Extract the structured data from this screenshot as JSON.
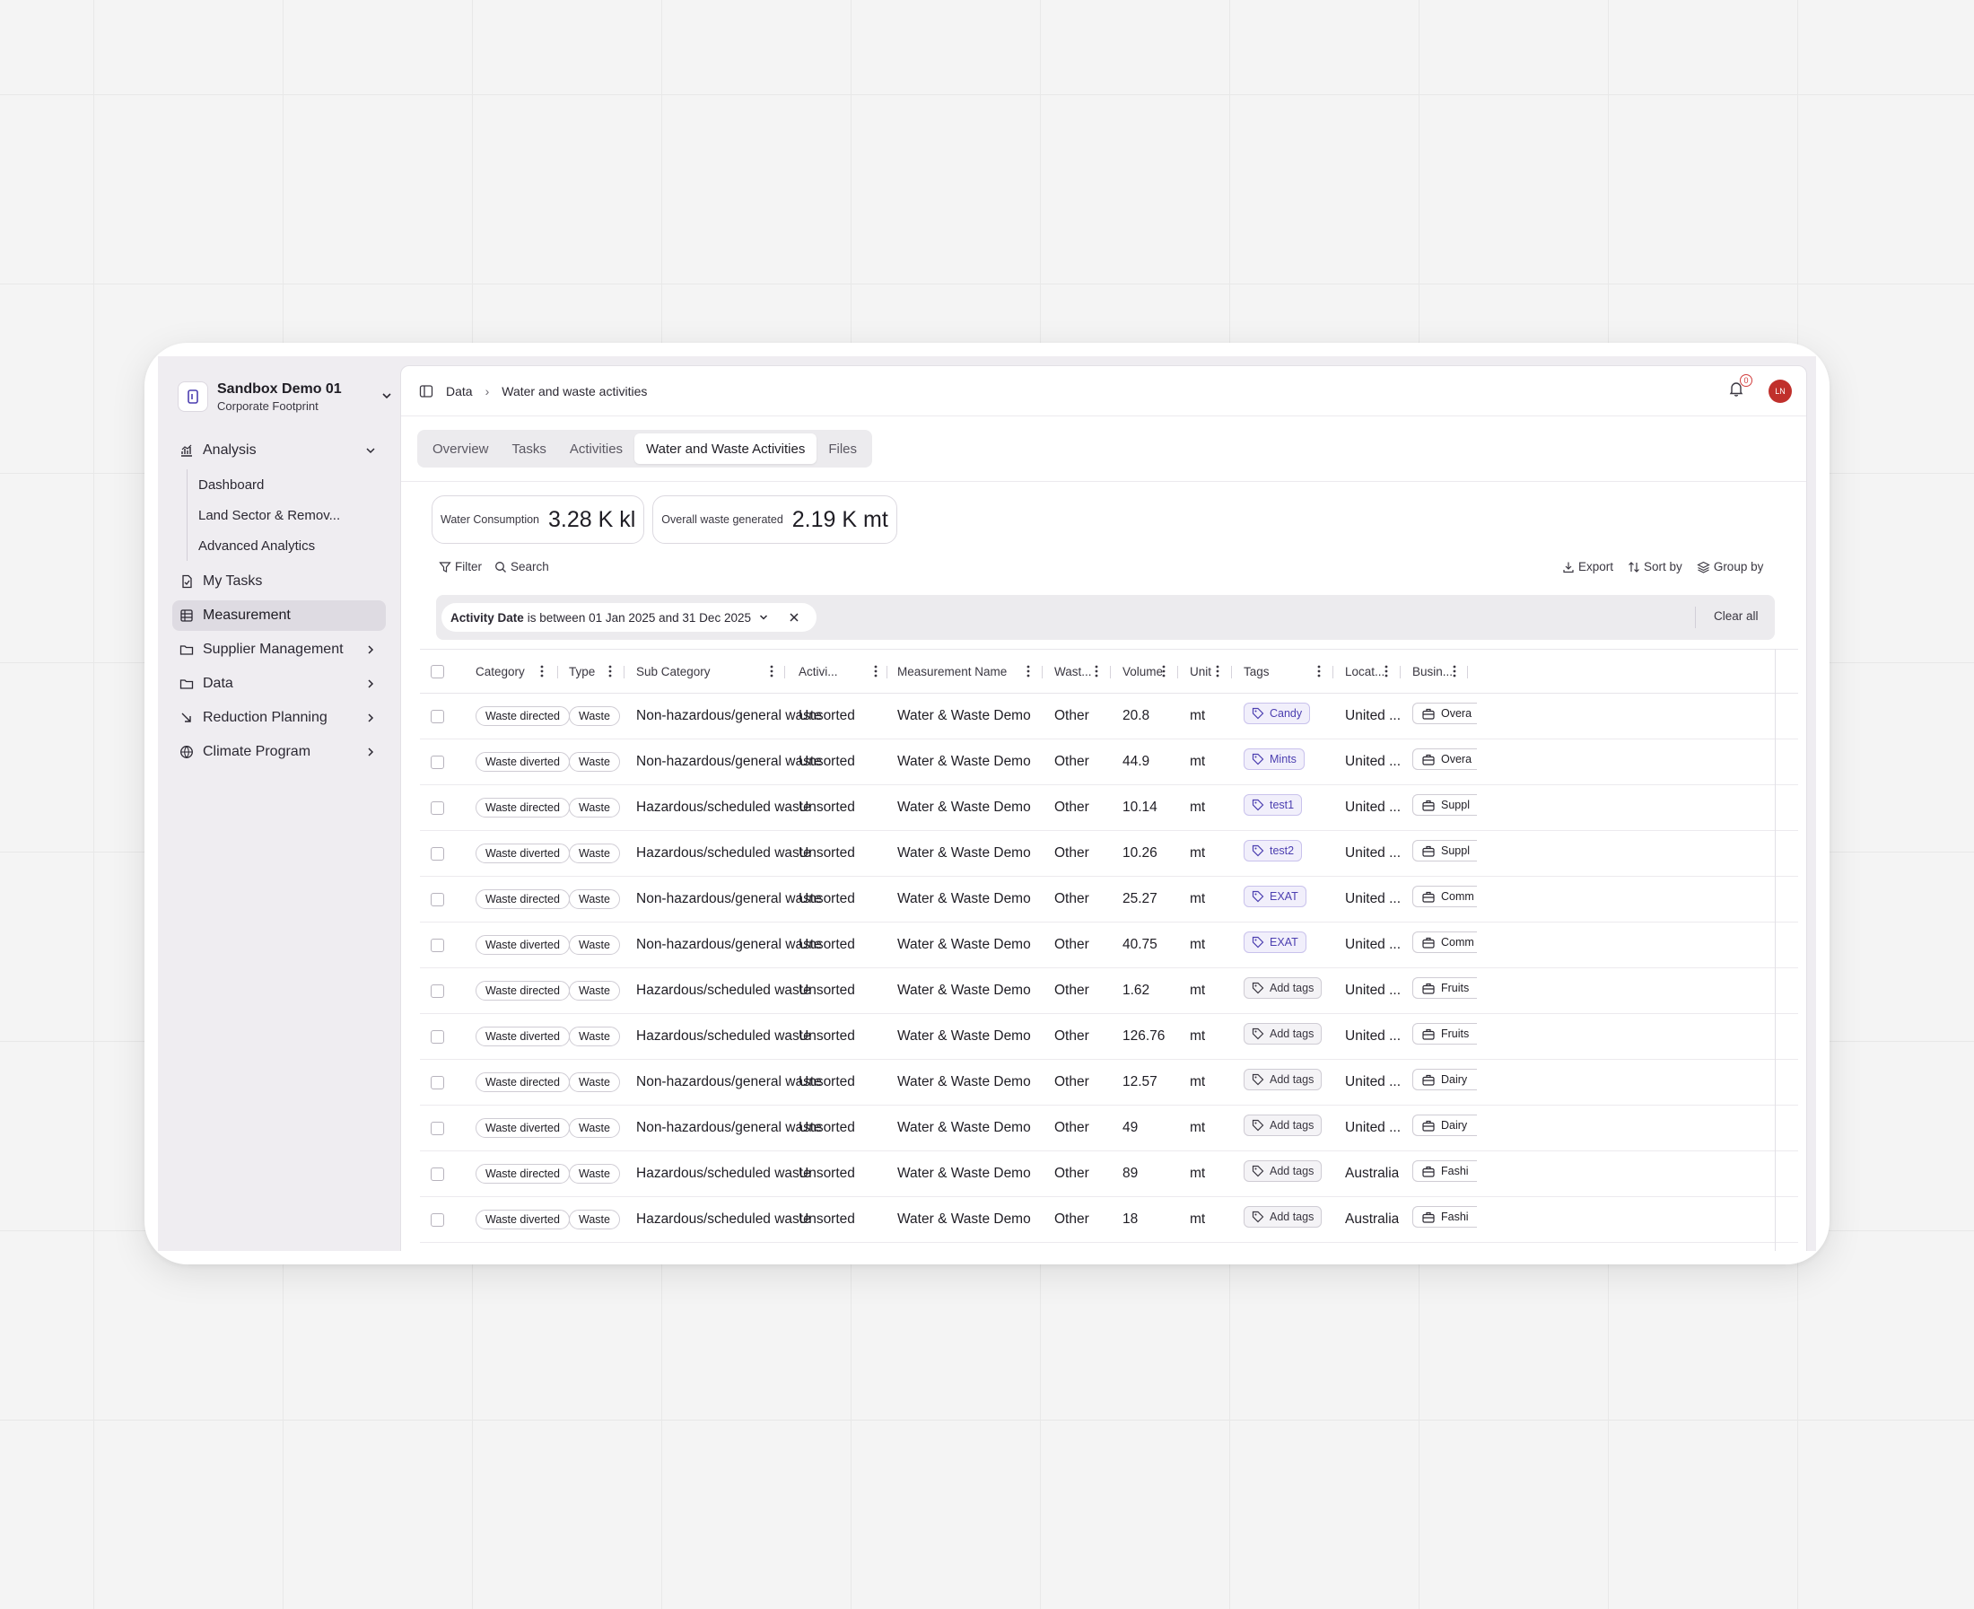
{
  "org": {
    "name": "Sandbox Demo 01",
    "subtitle": "Corporate Footprint"
  },
  "sidebar": {
    "analysis": {
      "label": "Analysis",
      "children": [
        "Dashboard",
        "Land Sector & Remov...",
        "Advanced Analytics"
      ]
    },
    "items": [
      {
        "label": "My Tasks"
      },
      {
        "label": "Measurement"
      },
      {
        "label": "Supplier Management"
      },
      {
        "label": "Data"
      },
      {
        "label": "Reduction Planning"
      },
      {
        "label": "Climate Program"
      }
    ]
  },
  "breadcrumb": [
    "Data",
    "Water and waste activities"
  ],
  "notifications": {
    "count": "0"
  },
  "user": {
    "initials": "LN",
    "avatar_color": "#c0302c"
  },
  "tabs": [
    "Overview",
    "Tasks",
    "Activities",
    "Water and Waste Activities",
    "Files"
  ],
  "active_tab": "Water and Waste Activities",
  "metrics": [
    {
      "label": "Water Consumption",
      "value": "3.28 K kl"
    },
    {
      "label": "Overall waste generated",
      "value": "2.19 K mt"
    }
  ],
  "toolbar": {
    "filter": "Filter",
    "search": "Search",
    "export": "Export",
    "sort_by": "Sort by",
    "group_by": "Group by"
  },
  "filter_chip": {
    "field": "Activity Date",
    "text": "is between 01 Jan 2025 and 31 Dec 2025",
    "clear_all": "Clear all"
  },
  "columns": [
    "Category",
    "Type",
    "Sub Category",
    "Activi...",
    "Measurement Name",
    "Wast...",
    "Volume",
    "Unit",
    "Tags",
    "Locat...",
    "Busin..."
  ],
  "rows": [
    {
      "category": "Waste directed",
      "type": "Waste",
      "subcategory": "Non-hazardous/general waste",
      "activity": "Unsorted",
      "measurement": "Water & Waste Demo",
      "waste": "Other",
      "volume": "20.8",
      "unit": "mt",
      "tag": "Candy",
      "location": "United ...",
      "business": "Overa"
    },
    {
      "category": "Waste diverted",
      "type": "Waste",
      "subcategory": "Non-hazardous/general waste",
      "activity": "Unsorted",
      "measurement": "Water & Waste Demo",
      "waste": "Other",
      "volume": "44.9",
      "unit": "mt",
      "tag": "Mints",
      "location": "United ...",
      "business": "Overa"
    },
    {
      "category": "Waste directed",
      "type": "Waste",
      "subcategory": "Hazardous/scheduled waste",
      "activity": "Unsorted",
      "measurement": "Water & Waste Demo",
      "waste": "Other",
      "volume": "10.14",
      "unit": "mt",
      "tag": "test1",
      "location": "United ...",
      "business": "Suppl"
    },
    {
      "category": "Waste diverted",
      "type": "Waste",
      "subcategory": "Hazardous/scheduled waste",
      "activity": "Unsorted",
      "measurement": "Water & Waste Demo",
      "waste": "Other",
      "volume": "10.26",
      "unit": "mt",
      "tag": "test2",
      "location": "United ...",
      "business": "Suppl"
    },
    {
      "category": "Waste directed",
      "type": "Waste",
      "subcategory": "Non-hazardous/general waste",
      "activity": "Unsorted",
      "measurement": "Water & Waste Demo",
      "waste": "Other",
      "volume": "25.27",
      "unit": "mt",
      "tag": "EXAT",
      "location": "United ...",
      "business": "Comm"
    },
    {
      "category": "Waste diverted",
      "type": "Waste",
      "subcategory": "Non-hazardous/general waste",
      "activity": "Unsorted",
      "measurement": "Water & Waste Demo",
      "waste": "Other",
      "volume": "40.75",
      "unit": "mt",
      "tag": "EXAT",
      "location": "United ...",
      "business": "Comm"
    },
    {
      "category": "Waste directed",
      "type": "Waste",
      "subcategory": "Hazardous/scheduled waste",
      "activity": "Unsorted",
      "measurement": "Water & Waste Demo",
      "waste": "Other",
      "volume": "1.62",
      "unit": "mt",
      "tag": "Add tags",
      "location": "United ...",
      "business": "Fruits"
    },
    {
      "category": "Waste diverted",
      "type": "Waste",
      "subcategory": "Hazardous/scheduled waste",
      "activity": "Unsorted",
      "measurement": "Water & Waste Demo",
      "waste": "Other",
      "volume": "126.76",
      "unit": "mt",
      "tag": "Add tags",
      "location": "United ...",
      "business": "Fruits"
    },
    {
      "category": "Waste directed",
      "type": "Waste",
      "subcategory": "Non-hazardous/general waste",
      "activity": "Unsorted",
      "measurement": "Water & Waste Demo",
      "waste": "Other",
      "volume": "12.57",
      "unit": "mt",
      "tag": "Add tags",
      "location": "United ...",
      "business": "Dairy"
    },
    {
      "category": "Waste diverted",
      "type": "Waste",
      "subcategory": "Non-hazardous/general waste",
      "activity": "Unsorted",
      "measurement": "Water & Waste Demo",
      "waste": "Other",
      "volume": "49",
      "unit": "mt",
      "tag": "Add tags",
      "location": "United ...",
      "business": "Dairy"
    },
    {
      "category": "Waste directed",
      "type": "Waste",
      "subcategory": "Hazardous/scheduled waste",
      "activity": "Unsorted",
      "measurement": "Water & Waste Demo",
      "waste": "Other",
      "volume": "89",
      "unit": "mt",
      "tag": "Add tags",
      "location": "Australia",
      "business": "Fashi"
    },
    {
      "category": "Waste diverted",
      "type": "Waste",
      "subcategory": "Hazardous/scheduled waste",
      "activity": "Unsorted",
      "measurement": "Water & Waste Demo",
      "waste": "Other",
      "volume": "18",
      "unit": "mt",
      "tag": "Add tags",
      "location": "Australia",
      "business": "Fashi"
    }
  ],
  "icons": {
    "sidebar": [
      "analysis-chart-icon",
      "tasks-file-icon",
      "table-grid-icon",
      "folder-icon",
      "folder-icon",
      "reduction-arrow-icon",
      "globe-icon"
    ],
    "tag": "tag-icon",
    "business": "briefcase-icon"
  },
  "colors": {
    "accent_purple": "#4c3fb0",
    "tag_bg": "#f1effb",
    "sidebar_bg": "#efedf1",
    "active_nav": "#dedbe2"
  }
}
